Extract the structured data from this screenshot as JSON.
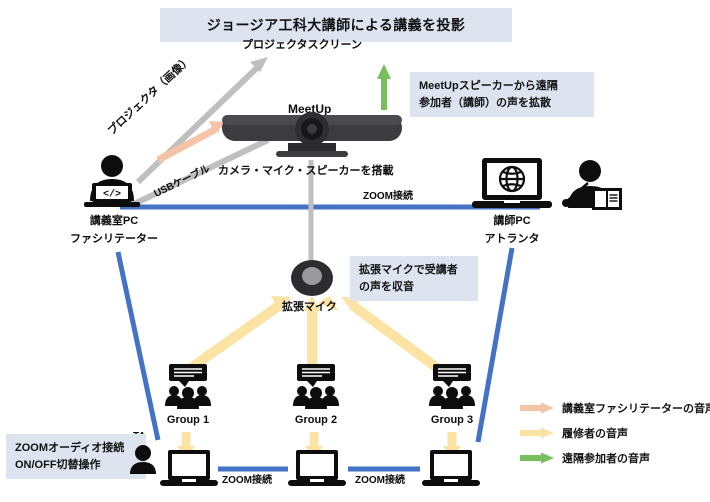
{
  "banner": {
    "text": "ジョージア工科大講師による講義を投影"
  },
  "labels": {
    "projector_screen": "プロジェクタスクリーン",
    "projector_image": "プロジェクタ（画像）",
    "usb_cable": "USBケーブル",
    "meetup": "MeetUp",
    "meetup_caption": "カメラ・マイク・スピーカーを搭載",
    "zoom_connection_main": "ZOOM接続",
    "classroom_pc_line1": "講義室PC",
    "classroom_pc_line2": "ファシリテーター",
    "instructor_pc_line1": "講師PC",
    "instructor_pc_line2": "アトランタ",
    "extension_mic": "拡張マイク",
    "ta": "TA",
    "zoom_connection_1": "ZOOM接続",
    "zoom_connection_2": "ZOOM接続"
  },
  "callouts": {
    "speaker": "MeetUpスピーカーから遠隔\n参加者（講師）の声を拡散",
    "mic": "拡張マイクで受講者\nの声を収音",
    "zoom_audio": "ZOOMオーディオ接続\nON/OFF切替操作"
  },
  "groups": [
    {
      "label": "Group 1"
    },
    {
      "label": "Group 2"
    },
    {
      "label": "Group 3"
    }
  ],
  "legend": [
    {
      "label": "講義室ファシリテーターの音声",
      "color": "#f5c4a6"
    },
    {
      "label": "履修者の音声",
      "color": "#fbe3a4"
    },
    {
      "label": "遠隔参加者の音声",
      "color": "#76bf5e"
    }
  ],
  "colors": {
    "banner_bg": "#dde4f0",
    "callout_bg": "#dde4f0",
    "zoom_blue": "#4472c4",
    "gray_line": "#bfbfbf",
    "orange_arrow": "#f5c4a6",
    "yellow_arrow": "#fbe3a4",
    "green_arrow": "#76bf5e",
    "icon_black": "#0d0d0d"
  }
}
